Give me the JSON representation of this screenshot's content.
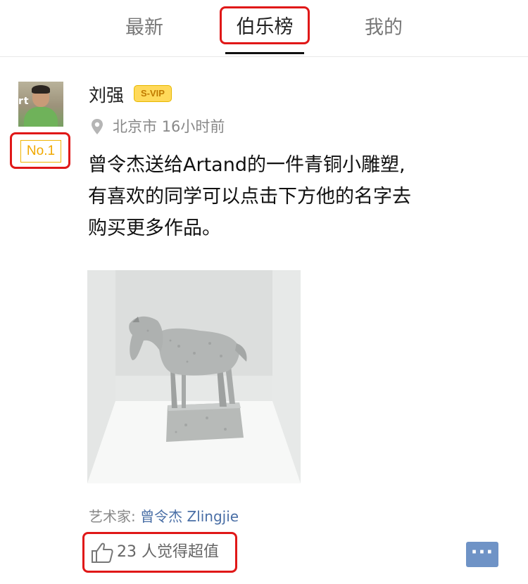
{
  "tabs": [
    {
      "label": "最新",
      "active": false
    },
    {
      "label": "伯乐榜",
      "active": true
    },
    {
      "label": "我的",
      "active": false
    }
  ],
  "post": {
    "rank": "No.1",
    "author": "刘强",
    "badge": "S-VIP",
    "avatar_text": "rt",
    "location": "北京市",
    "time": "16小时前",
    "content_lines": [
      "曾令杰送给Artand的一件青铜小雕塑,",
      "有喜欢的同学可以点击下方他的名字去",
      "购买更多作品。"
    ],
    "artist_label": "艺术家:",
    "artist_name": "曾令杰 Zlingjie",
    "likes": "23 人觉得超值",
    "more_label": "···"
  },
  "icons": {
    "location": "map-pin-icon",
    "like": "thumbs-up-icon",
    "more": "ellipsis-icon"
  },
  "colors": {
    "highlight": "#e01818",
    "rank": "#f0a800",
    "link": "#4a6fa6",
    "more_button": "#6f93c6"
  }
}
